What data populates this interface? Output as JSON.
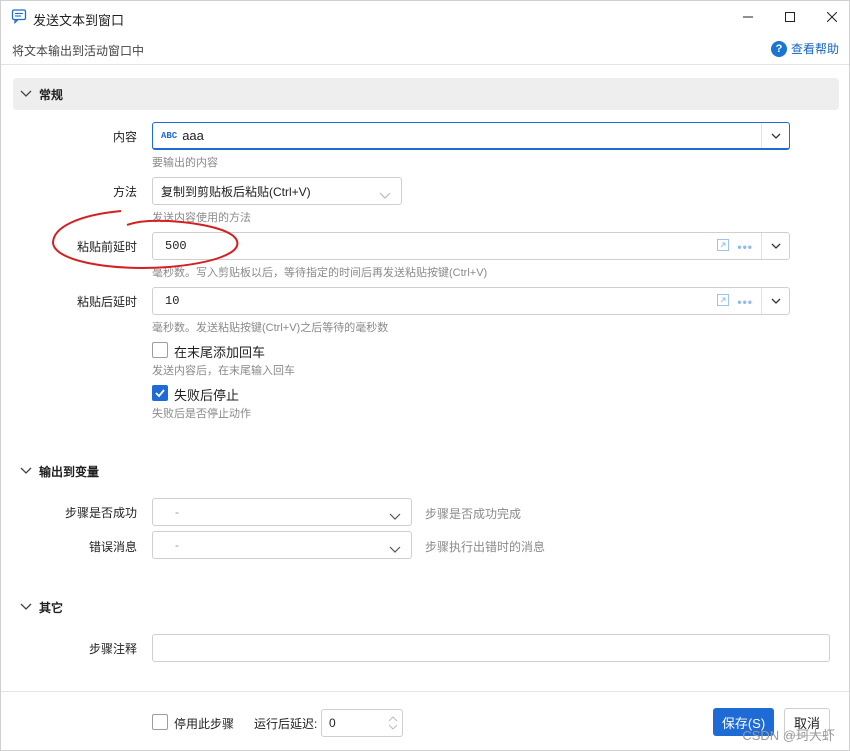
{
  "window": {
    "title": "发送文本到窗口",
    "subtitle": "将文本输出到活动窗口中",
    "help_label": "查看帮助"
  },
  "sections": {
    "general": "常规",
    "output": "输出到变量",
    "other": "其它"
  },
  "general": {
    "content": {
      "label": "内容",
      "badge": "ABC",
      "value": "aaa",
      "hint": "要输出的内容"
    },
    "method": {
      "label": "方法",
      "value": "复制到剪贴板后粘贴(Ctrl+V)",
      "hint": "发送内容使用的方法"
    },
    "paste_before": {
      "label": "粘贴前延时",
      "value": "500",
      "hint": "毫秒数。写入剪贴板以后，等待指定的时间后再发送粘贴按键(Ctrl+V)"
    },
    "paste_after": {
      "label": "粘贴后延时",
      "value": "10",
      "hint": "毫秒数。发送粘贴按键(Ctrl+V)之后等待的毫秒数"
    },
    "append_enter": {
      "label": "在末尾添加回车",
      "hint": "发送内容后，在末尾输入回车",
      "checked": false
    },
    "stop_on_fail": {
      "label": "失败后停止",
      "hint": "失败后是否停止动作",
      "checked": true
    }
  },
  "output": {
    "success": {
      "label": "步骤是否成功",
      "value": "-",
      "hint": "步骤是否成功完成"
    },
    "error": {
      "label": "错误消息",
      "value": "-",
      "hint": "步骤执行出错时的消息"
    }
  },
  "other": {
    "note_label": "步骤注释",
    "note_value": ""
  },
  "footer": {
    "disable_label": "停用此步骤",
    "delay_label": "运行后延迟:",
    "delay_value": "0",
    "save_label": "保存(S)",
    "cancel_label": "取消"
  },
  "watermark": "CSDN @珂大虾",
  "colors": {
    "accent": "#1e6bd6",
    "annotation": "#d42020"
  }
}
